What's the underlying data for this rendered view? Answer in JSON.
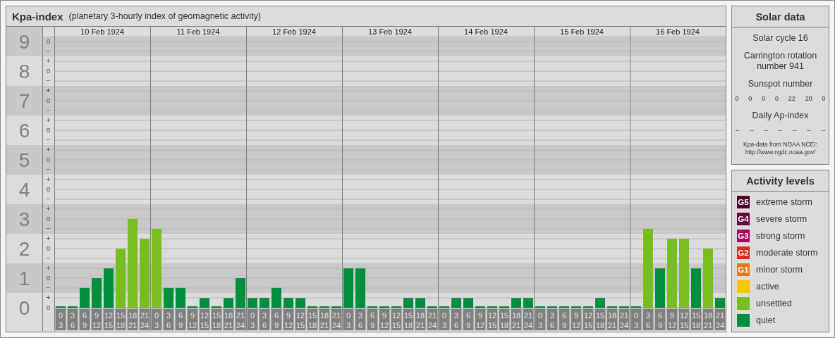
{
  "title": {
    "main": "Kpa-index",
    "subtitle": "(planetary 3-hourly index of geomagnetic activity)"
  },
  "days": [
    {
      "date": "10 Feb 1924"
    },
    {
      "date": "11 Feb 1924"
    },
    {
      "date": "12 Feb 1924"
    },
    {
      "date": "13 Feb 1924"
    },
    {
      "date": "14 Feb 1924"
    },
    {
      "date": "15 Feb 1924"
    },
    {
      "date": "16 Feb 1924"
    }
  ],
  "kp_scale_marks": [
    "o",
    "−",
    "+",
    "o",
    "−",
    "+",
    "o",
    "−",
    "+",
    "o",
    "−",
    "+",
    "o",
    "−",
    "+",
    "o",
    "−",
    "+",
    "o",
    "−",
    "+",
    "o",
    "−",
    "+",
    "o",
    "−",
    "+",
    "o"
  ],
  "chart_data": {
    "type": "bar",
    "stacked": true,
    "grid": true,
    "ylim": [
      0,
      9.17
    ],
    "categories": [
      "0 3",
      "3 6",
      "6 9",
      "9 12",
      "12 15",
      "15 18",
      "18 21",
      "21 24",
      "0 3",
      "3 6",
      "6 9",
      "9 12",
      "12 15",
      "15 18",
      "18 21",
      "21 24",
      "0 3",
      "3 6",
      "6 9",
      "9 12",
      "12 15",
      "15 18",
      "18 21",
      "21 24",
      "0 3",
      "3 6",
      "6 9",
      "9 12",
      "12 15",
      "15 18",
      "18 21",
      "21 24",
      "0 3",
      "3 6",
      "6 9",
      "9 12",
      "12 15",
      "15 18",
      "18 21",
      "21 24",
      "0 3",
      "3 6",
      "6 9",
      "9 12",
      "12 15",
      "15 18",
      "18 21",
      "21 24",
      "0 3",
      "3 6",
      "6 9",
      "9 12",
      "12 15",
      "15 18",
      "18 21",
      "21 24"
    ],
    "yticks": [
      {
        "value": 0,
        "label": "0"
      },
      {
        "value": 1,
        "label": "1"
      },
      {
        "value": 2,
        "label": "2"
      },
      {
        "value": 3,
        "label": "3"
      },
      {
        "value": 4,
        "label": "4"
      },
      {
        "value": 5,
        "label": "5"
      },
      {
        "value": 6,
        "label": "6"
      },
      {
        "value": 7,
        "label": "7"
      },
      {
        "value": 8,
        "label": "8"
      },
      {
        "value": 9,
        "label": "9"
      }
    ],
    "series": [
      {
        "color": "#008f3f",
        "values": [
          0,
          0,
          0.67,
          1,
          1.33,
          null,
          null,
          null,
          null,
          0.67,
          0.67,
          0,
          0.33,
          0,
          0.33,
          1,
          0.33,
          0.33,
          0.67,
          0.33,
          0.33,
          0,
          0,
          0,
          1.33,
          1.33,
          0,
          0,
          0,
          0.33,
          0.33,
          0,
          0,
          0.33,
          0.33,
          0,
          0,
          0,
          0.33,
          0.33,
          0,
          0,
          0,
          0,
          0,
          0.33,
          0,
          0,
          0,
          null,
          1.33,
          null,
          null,
          1.33,
          null,
          0.33
        ]
      },
      {
        "color": "#78be20",
        "values": [
          null,
          null,
          null,
          null,
          null,
          2,
          3,
          2.33,
          2.67,
          null,
          null,
          null,
          null,
          null,
          null,
          null,
          null,
          null,
          null,
          null,
          null,
          null,
          null,
          null,
          null,
          null,
          null,
          null,
          null,
          null,
          null,
          null,
          null,
          null,
          null,
          null,
          null,
          null,
          null,
          null,
          null,
          null,
          null,
          null,
          null,
          null,
          null,
          null,
          null,
          2.67,
          null,
          2.33,
          2.33,
          null,
          2,
          null
        ]
      }
    ]
  },
  "solar_data": {
    "title": "Solar data",
    "solar_cycle": "Solar cycle 16",
    "carrington": "Carrington rotation number 941",
    "sunspot_label": "Sunspot number",
    "sunspot_numbers": [
      "0",
      "0",
      "0",
      "0",
      "22",
      "20",
      "0"
    ],
    "ap_label": "Daily Ap-index",
    "ap_values": [
      "--",
      "--",
      "--",
      "--",
      "--",
      "--",
      "--"
    ],
    "source": "Kpa-data from NOAA NCEI:",
    "source_url": "http://www.ngdc.noaa.gov/"
  },
  "activity_levels": {
    "title": "Activity levels",
    "items": [
      {
        "code": "G5",
        "label": "extreme storm",
        "color": "#4a0027"
      },
      {
        "code": "G4",
        "label": "severe storm",
        "color": "#6e0043"
      },
      {
        "code": "G3",
        "label": "strong storm",
        "color": "#b0005e"
      },
      {
        "code": "G2",
        "label": "moderate storm",
        "color": "#d9291c"
      },
      {
        "code": "G1",
        "label": "minor storm",
        "color": "#e7771a"
      },
      {
        "label": "active",
        "color": "#f7c400"
      },
      {
        "label": "unsettled",
        "color": "#78be20"
      },
      {
        "label": "quiet",
        "color": "#008f3f"
      }
    ]
  }
}
